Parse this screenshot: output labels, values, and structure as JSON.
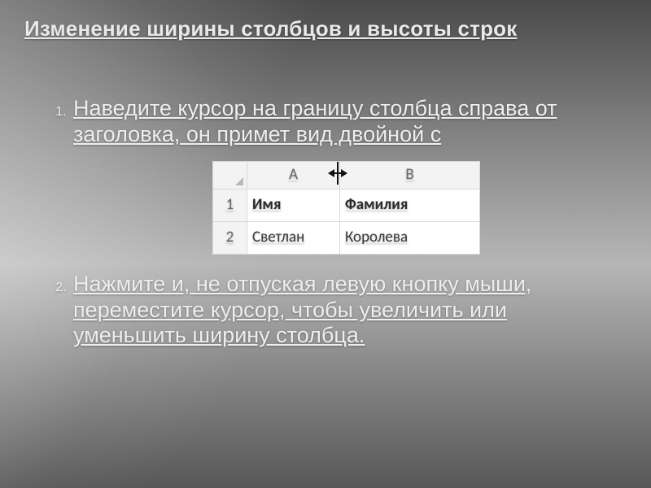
{
  "title": "Изменение ширины столбцов и высоты строк",
  "steps": {
    "s1": "Наведите курсор на границу столбца справа от заголовка, он примет вид двойной с",
    "s2": "Нажмите и, не отпуская левую кнопку мыши, переместите курсор, чтобы увеличить или уменьшить ширину столбца."
  },
  "excel": {
    "colA": "A",
    "colB": "B",
    "row1": "1",
    "row2": "2",
    "a1": "Имя",
    "b1": "Фамилия",
    "a2": "Светлан",
    "b2": "Королева"
  }
}
